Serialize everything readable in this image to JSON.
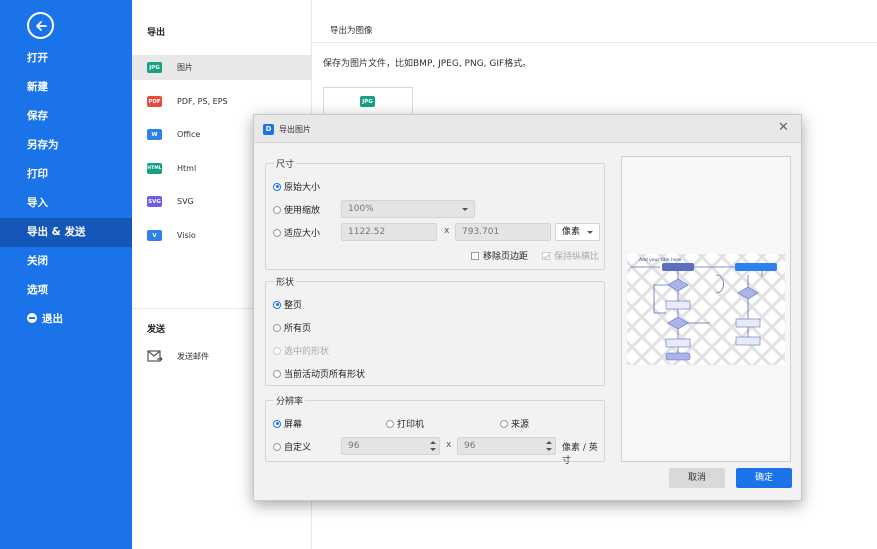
{
  "sidebar": {
    "back_icon": "back-arrow-icon",
    "items": [
      {
        "label": "打开"
      },
      {
        "label": "新建"
      },
      {
        "label": "保存"
      },
      {
        "label": "另存为"
      },
      {
        "label": "打印"
      },
      {
        "label": "导入"
      },
      {
        "label": "导出 & 发送",
        "active": true
      },
      {
        "label": "关闭"
      },
      {
        "label": "选项"
      },
      {
        "label": "退出",
        "icon": "logout-icon"
      }
    ],
    "color": "#1a73e8"
  },
  "middle": {
    "export_heading": "导出",
    "export_items": [
      {
        "label": "图片",
        "badge": "JPG",
        "color": "#16a085"
      },
      {
        "label": "PDF, PS, EPS",
        "badge": "PDF",
        "color": "#e74c3c"
      },
      {
        "label": "Office",
        "badge": "W",
        "color": "#2f80ed"
      },
      {
        "label": "Html",
        "badge": "HTML",
        "color": "#16a085"
      },
      {
        "label": "SVG",
        "badge": "SVG",
        "color": "#6c5ce7"
      },
      {
        "label": "Visio",
        "badge": "V",
        "color": "#2f80ed"
      }
    ],
    "send_heading": "发送",
    "send_items": [
      {
        "label": "发送邮件",
        "icon": "send-mail-icon"
      }
    ]
  },
  "right": {
    "title": "导出为图像",
    "description": "保存为图片文件，比如BMP, JPEG, PNG, GIF格式。",
    "thumb_badge": "JPG"
  },
  "dialog": {
    "title": "导出图片",
    "logo": "D",
    "close_icon": "close-icon",
    "size": {
      "label": "尺寸",
      "original": "原始大小",
      "scale": "使用缩放",
      "scale_value": "100%",
      "fit": "适应大小",
      "width": "1122.52",
      "times": "x",
      "height": "793.701",
      "unit": "像素",
      "remove_margin": "移除页边距",
      "keep_ratio": "保持纵横比"
    },
    "shape": {
      "label": "形状",
      "whole_page": "整页",
      "all_pages": "所有页",
      "selected": "选中的形状",
      "current_all": "当前活动页所有形状"
    },
    "resolution": {
      "label": "分辨率",
      "screen": "屏幕",
      "printer": "打印机",
      "source": "来源",
      "custom": "自定义",
      "x_value": "96",
      "times": "x",
      "y_value": "96",
      "unit": "像素 / 英寸"
    },
    "preview_caption": "Add your title here",
    "cancel": "取消",
    "ok": "确定"
  }
}
